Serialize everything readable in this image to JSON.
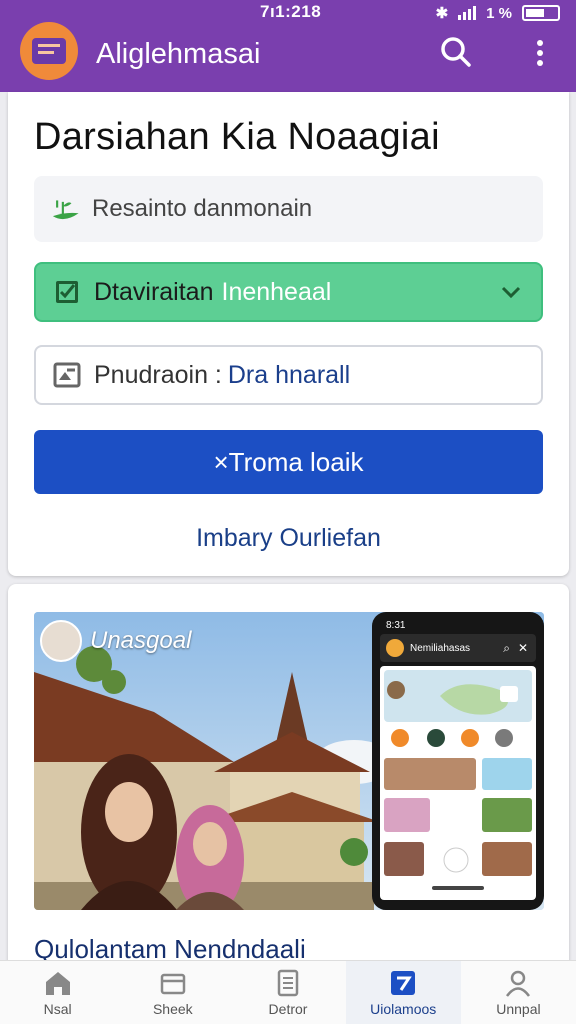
{
  "status_bar": {
    "time": "7ı1:218",
    "battery_text": "1 %"
  },
  "app_bar": {
    "title": "Aliglehmasai"
  },
  "main_card": {
    "heading": "Darsiahan Kia Noaagiai",
    "plain_row": {
      "label": "Resainto danmonain"
    },
    "select_row": {
      "label_prefix": "Dtaviraitan",
      "label_value": "Inenheaal"
    },
    "outline_row": {
      "label_prefix": "Pnudraoin :",
      "label_value": "Dra hnarall"
    },
    "primary_button": "×Troma loaik",
    "link": "Imbary Ourliefan"
  },
  "media_card": {
    "badge_text": "Unasgoal",
    "phone": {
      "time": "8:31",
      "title": "Nemiliahasas"
    },
    "caption": "Qulolantam Nendndaali"
  },
  "bottom_nav": [
    {
      "label": "Nsal",
      "icon": "home-icon",
      "active": false
    },
    {
      "label": "Sheek",
      "icon": "box-icon",
      "active": false
    },
    {
      "label": "Detror",
      "icon": "document-icon",
      "active": false
    },
    {
      "label": "Uiolamoos",
      "icon": "send-icon",
      "active": true
    },
    {
      "label": "Unnpal",
      "icon": "user-icon",
      "active": false
    }
  ],
  "colors": {
    "app_bar": "#7a3fae",
    "primary": "#1c4fc4",
    "select_green": "#5dcf94",
    "link": "#1a3f88"
  }
}
